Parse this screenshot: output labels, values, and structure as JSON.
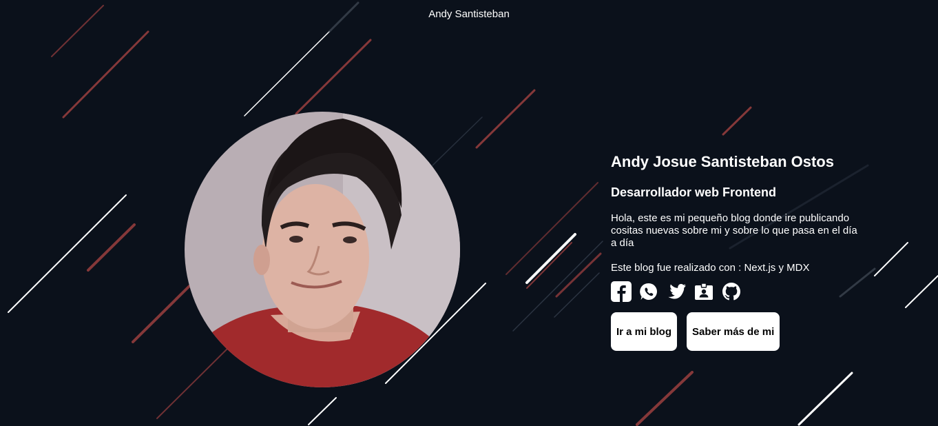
{
  "header": {
    "site_title": "Andy Santisteban"
  },
  "profile": {
    "name": "Andy Josue Santisteban Ostos",
    "role": "Desarrollador web Frontend",
    "bio": "Hola, este es mi pequeño blog donde ire publicando cositas nuevas sobre mi y sobre lo que pasa en el día a día",
    "tech": "Este blog fue realizado con : Next.js y MDX",
    "photo_alt": "Foto de Andy Santisteban"
  },
  "socials": [
    {
      "icon": "facebook-icon"
    },
    {
      "icon": "whatsapp-icon"
    },
    {
      "icon": "twitter-icon"
    },
    {
      "icon": "contact-card-icon"
    },
    {
      "icon": "github-icon"
    }
  ],
  "actions": {
    "blog_label": "Ir a mi blog",
    "about_label": "Saber más de mi"
  },
  "colors": {
    "background": "#0b111b",
    "accent_red": "#9b3f3f",
    "line_white": "#ffffff",
    "button_bg": "#ffffff"
  }
}
